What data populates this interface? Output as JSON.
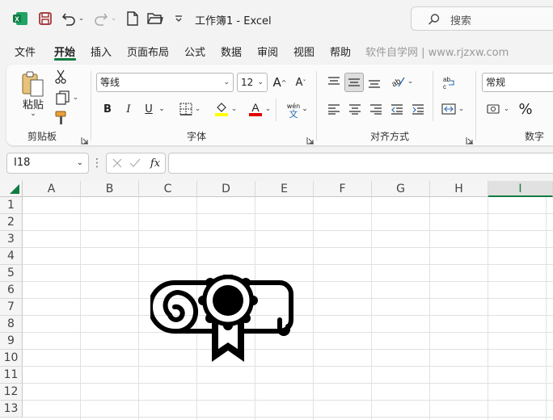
{
  "app": {
    "title": "工作簿1  -  Excel",
    "search_placeholder": "搜索"
  },
  "tabs": [
    {
      "label": "文件"
    },
    {
      "label": "开始"
    },
    {
      "label": "插入"
    },
    {
      "label": "页面布局"
    },
    {
      "label": "公式"
    },
    {
      "label": "数据"
    },
    {
      "label": "审阅"
    },
    {
      "label": "视图"
    },
    {
      "label": "帮助"
    }
  ],
  "watermark": "软件自学网 | www.rjzxw.com",
  "ribbon": {
    "clipboard": {
      "paste_label": "粘贴",
      "group_label": "剪贴板"
    },
    "font": {
      "font_name": "等线",
      "font_size": "12",
      "group_label": "字体",
      "bold": "B",
      "italic": "I",
      "underline": "U",
      "wen": "wén",
      "wen_char": "文"
    },
    "alignment": {
      "group_label": "对齐方式"
    },
    "number": {
      "format": "常规",
      "percent": "%",
      "group_label": "数字"
    }
  },
  "formula_bar": {
    "name_box": "I18",
    "fx": "fx",
    "value": ""
  },
  "grid": {
    "columns": [
      "A",
      "B",
      "C",
      "D",
      "E",
      "F",
      "G",
      "H",
      "I"
    ],
    "selected_column": "I",
    "rows": [
      "1",
      "2",
      "3",
      "4",
      "5",
      "6",
      "7",
      "8",
      "9",
      "10",
      "11",
      "12",
      "13"
    ]
  },
  "colors": {
    "accent": "#107c41",
    "excel_icon": "#107c41",
    "save_icon": "#a4373a",
    "highlight_yellow": "#ffff00",
    "font_red": "#e00000"
  },
  "icons": [
    "excel-app-icon",
    "save-icon",
    "undo-icon",
    "redo-icon",
    "new-file-icon",
    "open-folder-icon",
    "customize-icon",
    "search-icon",
    "diploma-icon"
  ]
}
